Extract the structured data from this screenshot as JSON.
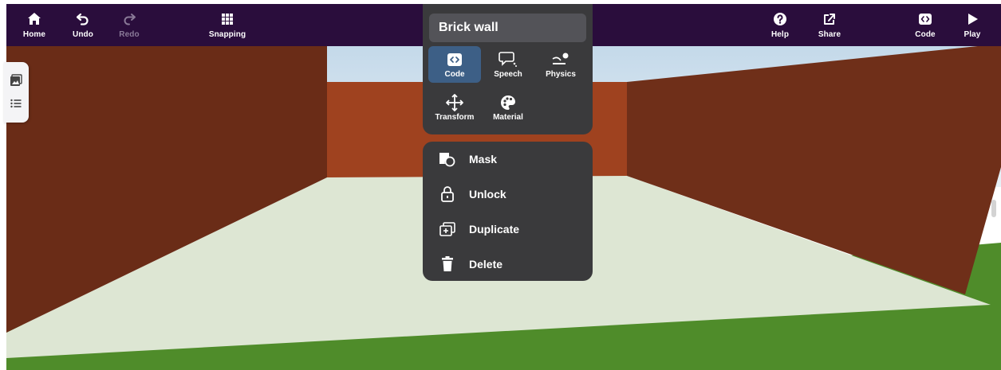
{
  "topbar": {
    "home": "Home",
    "undo": "Undo",
    "redo": "Redo",
    "snapping": "Snapping",
    "help": "Help",
    "share": "Share",
    "code": "Code",
    "play": "Play"
  },
  "panel": {
    "object_name": "Brick wall",
    "tools": [
      {
        "label": "Code",
        "icon": "code-icon",
        "active": true
      },
      {
        "label": "Speech",
        "icon": "speech-icon",
        "active": false
      },
      {
        "label": "Physics",
        "icon": "physics-icon",
        "active": false
      },
      {
        "label": "Transform",
        "icon": "transform-icon",
        "active": false
      },
      {
        "label": "Material",
        "icon": "palette-icon",
        "active": false
      }
    ]
  },
  "menu": {
    "items": [
      {
        "label": "Mask",
        "icon": "mask-icon"
      },
      {
        "label": "Unlock",
        "icon": "unlock-icon"
      },
      {
        "label": "Duplicate",
        "icon": "duplicate-icon"
      },
      {
        "label": "Delete",
        "icon": "trash-icon"
      }
    ]
  },
  "sidebar": {
    "icons": [
      "gallery-icon",
      "list-icon"
    ]
  },
  "colors": {
    "topbar": "#2a0d3c",
    "panel": "#3a3a3c",
    "active_tool": "#3d5f86",
    "wall_side": "#6e2e18",
    "wall_back": "#a0431f",
    "floor": "#dde6d3",
    "grass": "#4f8c2a",
    "sky": "#cfe0ee"
  }
}
